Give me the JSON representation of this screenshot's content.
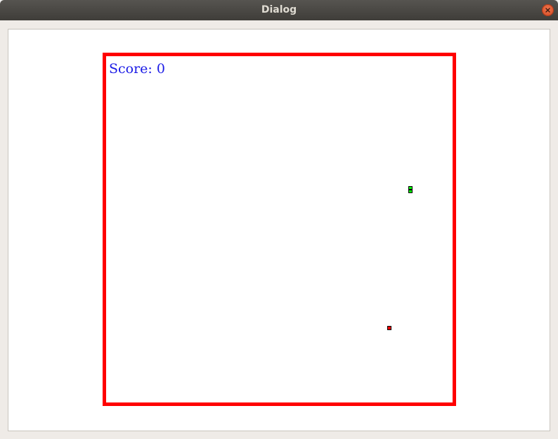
{
  "window": {
    "title": "Dialog"
  },
  "icons": {
    "close": "close-icon"
  },
  "game": {
    "score_text": "Score: 0",
    "colors": {
      "border": "#ff0000",
      "score": "#1a1ae6",
      "snake": "#00ff00",
      "food": "#ff0000"
    }
  }
}
